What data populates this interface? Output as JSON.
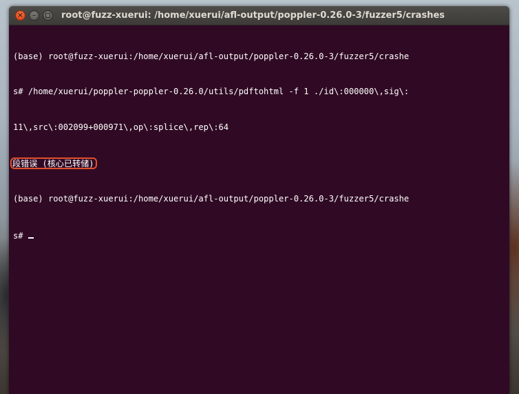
{
  "window": {
    "title": "root@fuzz-xuerui: /home/xuerui/afl-output/poppler-0.26.0-3/fuzzer5/crashes",
    "buttons": {
      "close": "×",
      "minimize": "–"
    }
  },
  "terminal": {
    "lines": [
      "(base) root@fuzz-xuerui:/home/xuerui/afl-output/poppler-0.26.0-3/fuzzer5/crashe",
      "s# /home/xuerui/poppler-poppler-0.26.0/utils/pdftohtml -f 1 ./id\\:000000\\,sig\\:",
      "11\\,src\\:002099+000971\\,op\\:splice\\,rep\\:64",
      "段错误 (核心已转储)",
      "(base) root@fuzz-xuerui:/home/xuerui/afl-output/poppler-0.26.0-3/fuzzer5/crashe",
      "s# "
    ],
    "highlight_color": "#e3502c",
    "background_color": "#300a24"
  }
}
